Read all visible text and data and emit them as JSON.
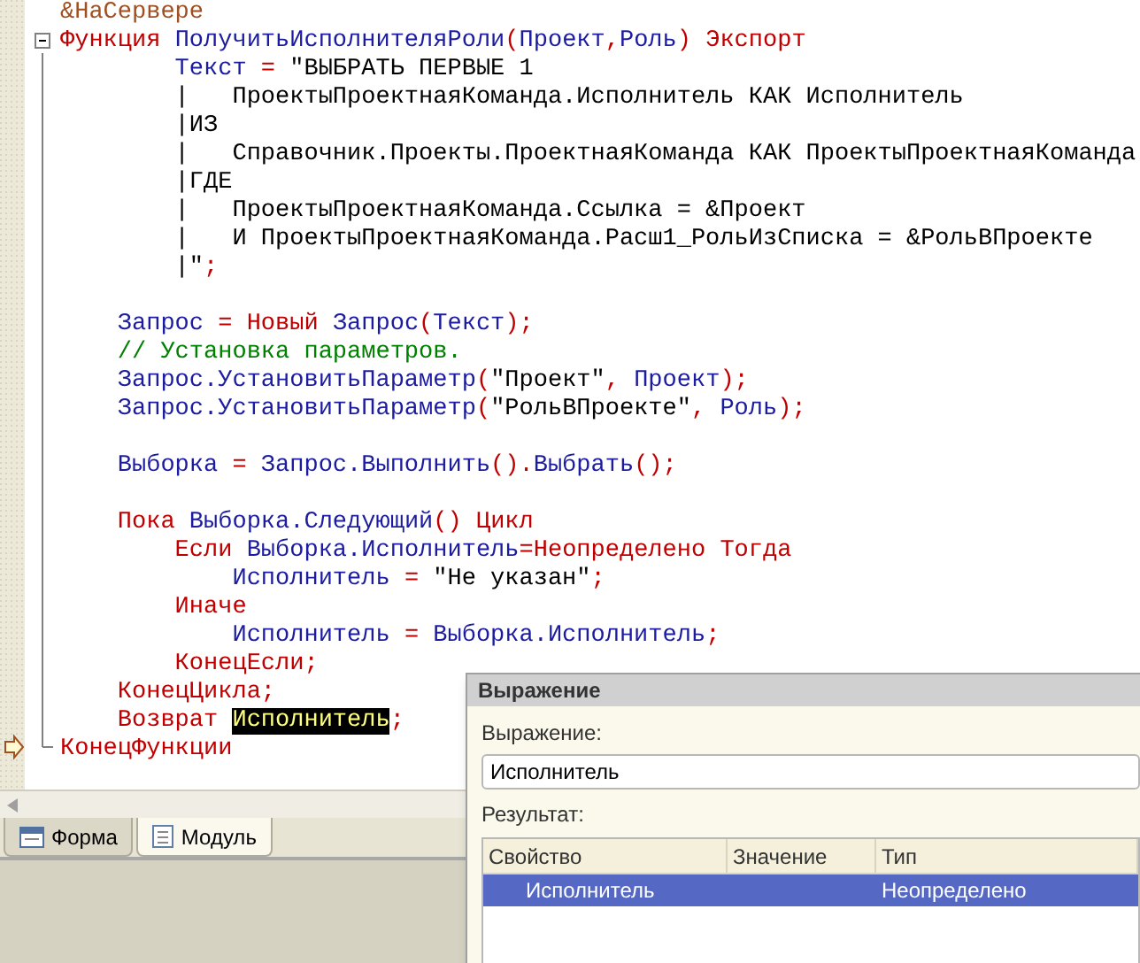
{
  "code_blocks": [
    [
      [
        {
          "text": "&НаСервере",
          "kind": "dir"
        }
      ],
      [
        {
          "text": "Функция ",
          "kind": "kw"
        },
        {
          "text": "ПолучитьИсполнителяРоли",
          "kind": "id"
        },
        {
          "text": "(",
          "kind": "op"
        },
        {
          "text": "Проект",
          "kind": "id"
        },
        {
          "text": ",",
          "kind": "op"
        },
        {
          "text": "Роль",
          "kind": "id"
        },
        {
          "text": ") ",
          "kind": "op"
        },
        {
          "text": "Экспорт",
          "kind": "kw"
        }
      ],
      [
        {
          "text": "        Текст ",
          "kind": "id"
        },
        {
          "text": "= ",
          "kind": "op"
        },
        {
          "text": "\"ВЫБРАТЬ ПЕРВЫЕ 1",
          "kind": "str"
        }
      ],
      [
        {
          "text": "        |   ПроектыПроектнаяКоманда.Исполнитель КАК Исполнитель",
          "kind": "str"
        }
      ],
      [
        {
          "text": "        |ИЗ",
          "kind": "str"
        }
      ],
      [
        {
          "text": "        |   Справочник.Проекты.ПроектнаяКоманда КАК ПроектыПроектнаяКоманда",
          "kind": "str"
        }
      ],
      [
        {
          "text": "        |ГДЕ",
          "kind": "str"
        }
      ],
      [
        {
          "text": "        |   ПроектыПроектнаяКоманда.Ссылка = &Проект",
          "kind": "str"
        }
      ],
      [
        {
          "text": "        |   И ПроектыПроектнаяКоманда.Расш1_РольИзСписка = &РольВПроекте",
          "kind": "str"
        }
      ],
      [
        {
          "text": "        |\"",
          "kind": "str"
        },
        {
          "text": ";",
          "kind": "op"
        }
      ]
    ],
    [
      [
        {
          "text": "    Запрос ",
          "kind": "id"
        },
        {
          "text": "= ",
          "kind": "op"
        },
        {
          "text": "Новый ",
          "kind": "kw"
        },
        {
          "text": "Запрос",
          "kind": "id"
        },
        {
          "text": "(",
          "kind": "op"
        },
        {
          "text": "Текст",
          "kind": "id"
        },
        {
          "text": ");",
          "kind": "op"
        }
      ],
      [
        {
          "text": "    // Установка параметров.",
          "kind": "cmt"
        }
      ],
      [
        {
          "text": "    Запрос.УстановитьПараметр",
          "kind": "id"
        },
        {
          "text": "(",
          "kind": "op"
        },
        {
          "text": "\"Проект\"",
          "kind": "str"
        },
        {
          "text": ", ",
          "kind": "op"
        },
        {
          "text": "Проект",
          "kind": "id"
        },
        {
          "text": ");",
          "kind": "op"
        }
      ],
      [
        {
          "text": "    Запрос.УстановитьПараметр",
          "kind": "id"
        },
        {
          "text": "(",
          "kind": "op"
        },
        {
          "text": "\"РольВПроекте\"",
          "kind": "str"
        },
        {
          "text": ", ",
          "kind": "op"
        },
        {
          "text": "Роль",
          "kind": "id"
        },
        {
          "text": ");",
          "kind": "op"
        }
      ]
    ],
    [
      [
        {
          "text": "    Выборка ",
          "kind": "id"
        },
        {
          "text": "= ",
          "kind": "op"
        },
        {
          "text": "Запрос.Выполнить",
          "kind": "id"
        },
        {
          "text": "().",
          "kind": "op"
        },
        {
          "text": "Выбрать",
          "kind": "id"
        },
        {
          "text": "();",
          "kind": "op"
        }
      ]
    ],
    [
      [
        {
          "text": "    Пока ",
          "kind": "kw"
        },
        {
          "text": "Выборка.Следующий",
          "kind": "id"
        },
        {
          "text": "() ",
          "kind": "op"
        },
        {
          "text": "Цикл",
          "kind": "kw"
        }
      ],
      [
        {
          "text": "        Если ",
          "kind": "kw"
        },
        {
          "text": "Выборка.Исполнитель",
          "kind": "id"
        },
        {
          "text": "=",
          "kind": "op"
        },
        {
          "text": "Неопределено Тогда",
          "kind": "kw"
        }
      ],
      [
        {
          "text": "            Исполнитель ",
          "kind": "id"
        },
        {
          "text": "= ",
          "kind": "op"
        },
        {
          "text": "\"Не указан\"",
          "kind": "str"
        },
        {
          "text": ";",
          "kind": "op"
        }
      ],
      [
        {
          "text": "        Иначе",
          "kind": "kw"
        }
      ],
      [
        {
          "text": "            Исполнитель ",
          "kind": "id"
        },
        {
          "text": "= ",
          "kind": "op"
        },
        {
          "text": "Выборка.Исполнитель",
          "kind": "id"
        },
        {
          "text": ";",
          "kind": "op"
        }
      ],
      [
        {
          "text": "        КонецЕсли;",
          "kind": "kw"
        }
      ],
      [
        {
          "text": "    КонецЦикла;",
          "kind": "kw"
        }
      ],
      [
        {
          "text": "    Возврат ",
          "kind": "kw"
        },
        {
          "text": "Исполнитель",
          "kind": "hl"
        },
        {
          "text": ";",
          "kind": "op"
        }
      ],
      [
        {
          "text": "КонецФункции",
          "kind": "kw"
        }
      ]
    ]
  ],
  "tabs": [
    {
      "label": "Форма",
      "selected": false
    },
    {
      "label": "Модуль",
      "selected": true
    }
  ],
  "dialog": {
    "title": "Выражение",
    "expression_label": "Выражение:",
    "expression_value": "Исполнитель",
    "result_label": "Результат:",
    "columns": [
      "Свойство",
      "Значение",
      "Тип"
    ],
    "rows": [
      {
        "property": "Исполнитель",
        "type": "Неопределено",
        "selected": true
      }
    ]
  }
}
